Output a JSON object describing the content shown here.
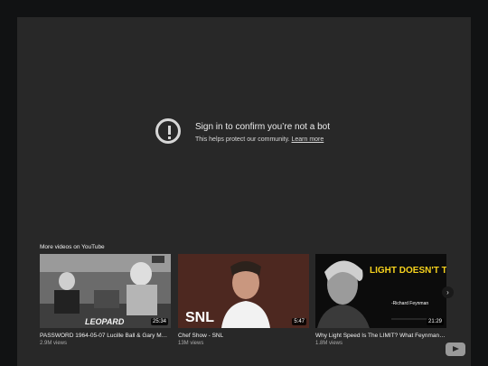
{
  "notice": {
    "title": "Sign in to confirm you’re not a bot",
    "subtitle": "This helps protect our community.",
    "link": "Learn more"
  },
  "more_videos": {
    "heading": "More videos on YouTube",
    "items": [
      {
        "title": "PASSWORD 1964-05-07 Lucille Ball & Gary Moore",
        "views": "2.9M views",
        "duration": "25:34",
        "thumb_text": "LEOPARD"
      },
      {
        "title": "Chef Show - SNL",
        "views": "13M views",
        "duration": "5:47",
        "thumb_text": "SNL"
      },
      {
        "title": "Why Light Speed Is The LIMIT? What Feynman Said",
        "views": "1.8M views",
        "duration": "21:29",
        "thumb_text": "LIGHT DOESN'T TRAVEL",
        "thumb_sub": "-Richard Feynman"
      }
    ],
    "next_icon": "chevron-right-icon"
  },
  "icons": {
    "alert": "alert-circle-icon",
    "logo": "youtube-logo-icon"
  }
}
